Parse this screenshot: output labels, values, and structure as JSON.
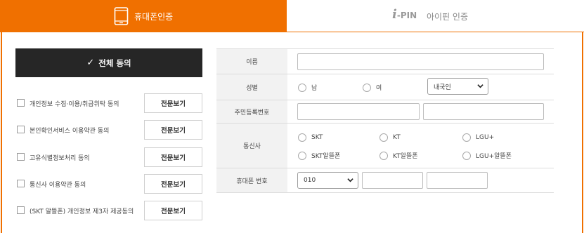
{
  "tabs": {
    "phone_label": "휴대폰인증",
    "ipin_logo_i": "i",
    "ipin_logo_pin": "-PIN",
    "ipin_label": "아이핀 인증"
  },
  "agree_all": {
    "check": "✓",
    "label": "전체 동의"
  },
  "terms": [
    {
      "label": "개인정보 수집·이용/취급위탁 동의",
      "view": "전문보기"
    },
    {
      "label": "본인확인서비스 이용약관 동의",
      "view": "전문보기"
    },
    {
      "label": "고유식별정보처리 동의",
      "view": "전문보기"
    },
    {
      "label": "통신사 이용약관 동의",
      "view": "전문보기"
    },
    {
      "label": "(SKT 알뜰폰) 개인정보 제3자 제공동의",
      "view": "전문보기"
    }
  ],
  "form": {
    "name_label": "이름",
    "gender_label": "성별",
    "gender_male": "남",
    "gender_female": "여",
    "nationality_selected": "내국인",
    "resident_label": "주민등록번호",
    "carrier_label": "통신사",
    "carriers": [
      "SKT",
      "KT",
      "LGU+",
      "SKT알뜰폰",
      "KT알뜰폰",
      "LGU+알뜰폰"
    ],
    "phone_label": "휴대폰 번호",
    "phone_prefix_selected": "010"
  },
  "colors": {
    "accent": "#f07000",
    "dark_button": "#262626",
    "label_bg": "#f2f2f2"
  }
}
